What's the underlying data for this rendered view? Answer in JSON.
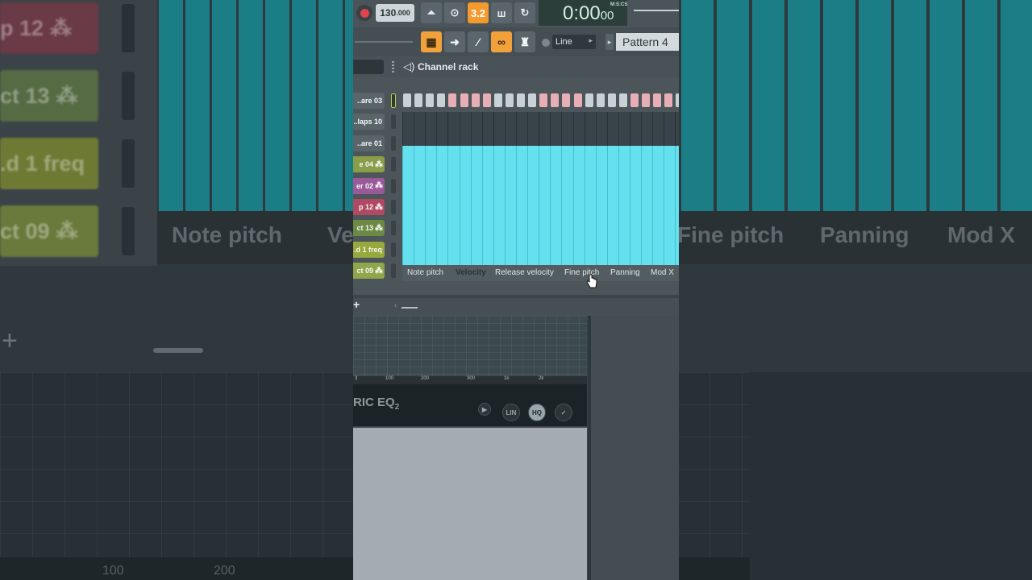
{
  "background": {
    "channels": [
      {
        "label": "p 12",
        "color": "#6a3a46",
        "wave": true
      },
      {
        "label": "ct 13",
        "color": "#566a44",
        "wave": true
      },
      {
        "label": ".d 1 freq",
        "color": "#6e7a34",
        "wave": false
      },
      {
        "label": "ct 09",
        "color": "#6a7a3c",
        "wave": true
      }
    ],
    "tabs": [
      "Note pitch",
      "Vel",
      "Fine pitch",
      "Panning",
      "Mod X"
    ],
    "ruler": [
      "100",
      "200"
    ]
  },
  "toolbar": {
    "tempo_main": "130",
    "tempo_fraction": ".000",
    "clock_main": "0:00",
    "clock_sub": "00",
    "clock_mode": "M:S:CS",
    "counter_label": "3.2",
    "icons": [
      "metronome-icon",
      "wait-icon",
      "countdown-icon",
      "step-edit-icon",
      "loop-record-icon"
    ]
  },
  "toolbar2": {
    "snap_label": "Line",
    "pattern_label": "Pattern 4",
    "icons": [
      "piano-roll-icon",
      "arrow-icon",
      "brush-icon",
      "link-icon",
      "stamp-icon"
    ]
  },
  "channel_rack": {
    "title": "Channel rack",
    "channels": [
      {
        "label": "..are 03",
        "color": "#5a656a",
        "wave": false,
        "led_on": true
      },
      {
        "label": "..laps 10",
        "color": "#5a656a",
        "wave": false,
        "led_on": false
      },
      {
        "label": "..are 01",
        "color": "#5a656a",
        "wave": false,
        "led_on": false
      },
      {
        "label": "e 04",
        "color": "#8a9d48",
        "wave": true,
        "led_on": false
      },
      {
        "label": "er 02",
        "color": "#9a5a9a",
        "wave": true,
        "led_on": false
      },
      {
        "label": "p 12",
        "color": "#b04a62",
        "wave": true,
        "led_on": false
      },
      {
        "label": "ct 13",
        "color": "#6d8a45",
        "wave": true,
        "led_on": false
      },
      {
        "label": ".d 1 freq",
        "color": "#97a83c",
        "wave": false,
        "led_on": false
      },
      {
        "label": "ct 09",
        "color": "#8fa64a",
        "wave": true,
        "led_on": false
      }
    ],
    "event_tabs": [
      {
        "label": "Note pitch",
        "active": false
      },
      {
        "label": "Velocity",
        "active": true
      },
      {
        "label": "Release velocity",
        "active": false
      },
      {
        "label": "Fine pitch",
        "active": false
      },
      {
        "label": "Panning",
        "active": false
      },
      {
        "label": "Mod X",
        "active": false
      }
    ],
    "step_count": 25,
    "velocity_fraction": 0.78,
    "add_label": "+"
  },
  "eq": {
    "name": "RIC EQ",
    "name_sub": "2",
    "ruler": [
      "3",
      "100",
      "200",
      "300",
      "1k",
      "2k"
    ],
    "buttons": [
      "LIN",
      "HQ",
      "✓"
    ]
  },
  "colors": {
    "accent": "#f29a2e",
    "velocity_bars": "#64e0ef",
    "step_pink": "#e7aeb6",
    "step_gray": "#c8d1d5"
  }
}
